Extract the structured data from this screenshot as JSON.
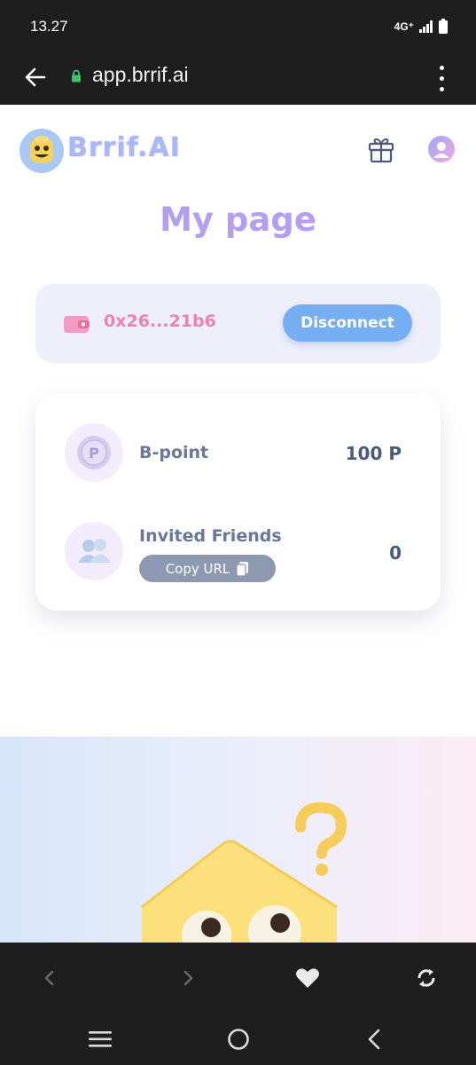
{
  "status_bar": {
    "time": "13.27",
    "network": "4G⁺"
  },
  "browser": {
    "url": "app.brrif.ai"
  },
  "header": {
    "logo_text": "Brrif.AI"
  },
  "page": {
    "title": "My page"
  },
  "wallet": {
    "address": "0x26...21b6",
    "disconnect_label": "Disconnect"
  },
  "stats": {
    "bpoint_label": "B-point",
    "bpoint_value": "100 P",
    "coin_letter": "P",
    "friends_label": "Invited Friends",
    "copy_url_label": "Copy URL",
    "friends_value": "0"
  },
  "colors": {
    "accent_blue": "#76aef3",
    "accent_pink": "#f07fb4",
    "title_purple": "#b39ef0",
    "dark_bar": "#1e1e1e"
  }
}
